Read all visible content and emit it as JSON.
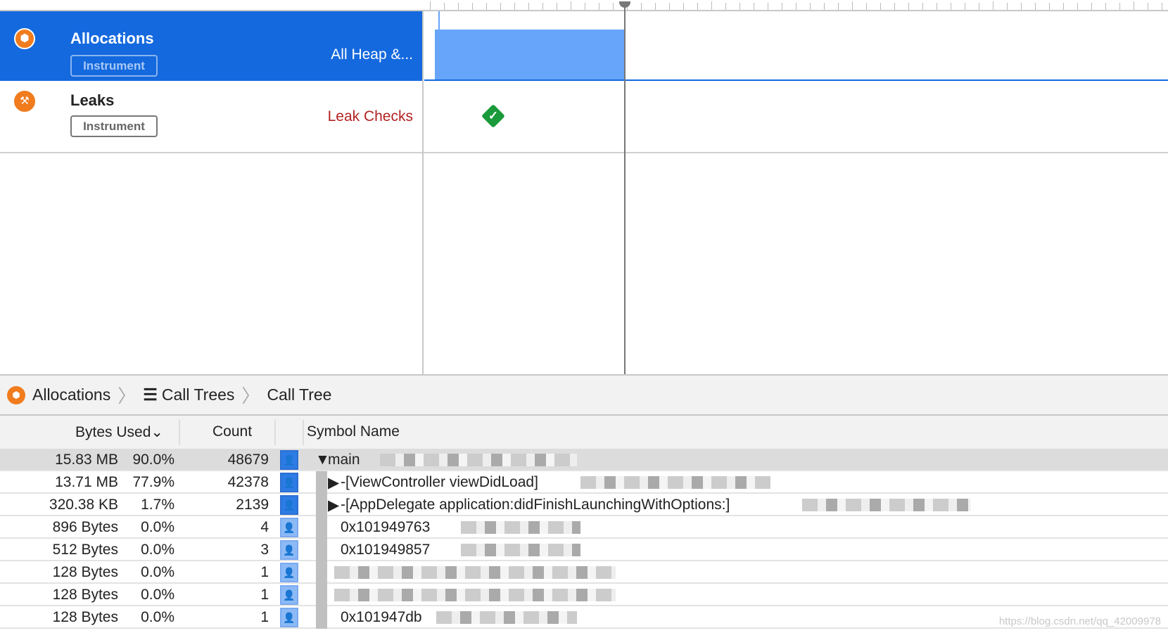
{
  "tracks": [
    {
      "name": "Allocations",
      "badge": "Instrument",
      "subtitle": "All Heap &...",
      "icon": "allocations-icon",
      "selected": true
    },
    {
      "name": "Leaks",
      "badge": "Instrument",
      "subtitle": "Leak Checks",
      "icon": "leaks-icon",
      "selected": false
    }
  ],
  "breadcrumb": {
    "items": [
      "Allocations",
      "Call Trees",
      "Call Tree"
    ]
  },
  "table": {
    "columns": [
      "Bytes Used",
      "Count",
      "Symbol Name"
    ],
    "sort_indicator": "⌄",
    "rows": [
      {
        "bytes": "15.83 MB",
        "pct": "90.0%",
        "count": "48679",
        "symbol": "main",
        "expand": "▼",
        "selected": true
      },
      {
        "bytes": "13.71 MB",
        "pct": "77.9%",
        "count": "42378",
        "symbol": "-[ViewController viewDidLoad]",
        "expand": "▶"
      },
      {
        "bytes": "320.38 KB",
        "pct": "1.7%",
        "count": "2139",
        "symbol": "-[AppDelegate application:didFinishLaunchingWithOptions:]",
        "expand": "▶"
      },
      {
        "bytes": "896 Bytes",
        "pct": "0.0%",
        "count": "4",
        "symbol": "0x101949763",
        "expand": ""
      },
      {
        "bytes": "512 Bytes",
        "pct": "0.0%",
        "count": "3",
        "symbol": "0x101949857",
        "expand": ""
      },
      {
        "bytes": "128 Bytes",
        "pct": "0.0%",
        "count": "1",
        "symbol": "",
        "expand": ""
      },
      {
        "bytes": "128 Bytes",
        "pct": "0.0%",
        "count": "1",
        "symbol": "",
        "expand": ""
      },
      {
        "bytes": "128 Bytes",
        "pct": "0.0%",
        "count": "1",
        "symbol": "0x101947db",
        "expand": ""
      }
    ]
  },
  "watermark": "https://blog.csdn.net/qq_42009978",
  "colors": {
    "selection": "#1469de",
    "graph": "#66a5fa",
    "leak_ok": "#1a9a3a",
    "instrument": "#f07c1e"
  }
}
